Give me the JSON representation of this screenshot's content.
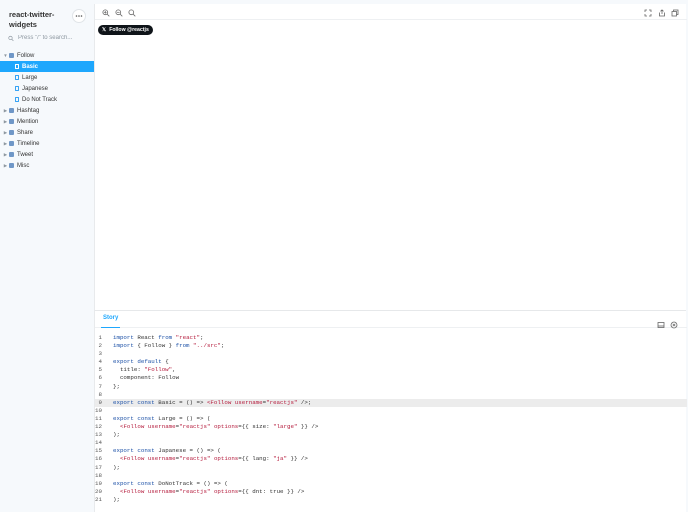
{
  "sidebar": {
    "brand": "react-twitter-widgets",
    "search_placeholder": "Press \"/\" to search...",
    "tree": [
      {
        "label": "Follow",
        "expanded": true,
        "children": [
          {
            "label": "Basic",
            "active": true
          },
          {
            "label": "Large"
          },
          {
            "label": "Japanese"
          },
          {
            "label": "Do Not Track"
          }
        ]
      },
      {
        "label": "Hashtag"
      },
      {
        "label": "Mention"
      },
      {
        "label": "Share"
      },
      {
        "label": "Timeline"
      },
      {
        "label": "Tweet"
      },
      {
        "label": "Misc"
      }
    ]
  },
  "preview": {
    "follow_button_label": "Follow @reactjs",
    "x_glyph": "𝕏"
  },
  "story_panel": {
    "tab_label": "Story",
    "highlighted_line": 9,
    "code_lines": [
      "import React from \"react\";",
      "import { Follow } from \"../src\";",
      "",
      "export default {",
      "  title: \"Follow\",",
      "  component: Follow",
      "};",
      "",
      "export const Basic = () => <Follow username=\"reactjs\" />;",
      "",
      "export const Large = () => (",
      "  <Follow username=\"reactjs\" options={{ size: \"large\" }} />",
      ");",
      "",
      "export const Japanese = () => (",
      "  <Follow username=\"reactjs\" options={{ lang: \"ja\" }} />",
      ");",
      "",
      "export const DoNotTrack = () => (",
      "  <Follow username=\"reactjs\" options={{ dnt: true }} />",
      ");"
    ]
  },
  "colors": {
    "accent": "#1ea7fd",
    "keyword": "#1a4fa6",
    "string": "#b51c3d",
    "button_bg": "#0f1419"
  }
}
